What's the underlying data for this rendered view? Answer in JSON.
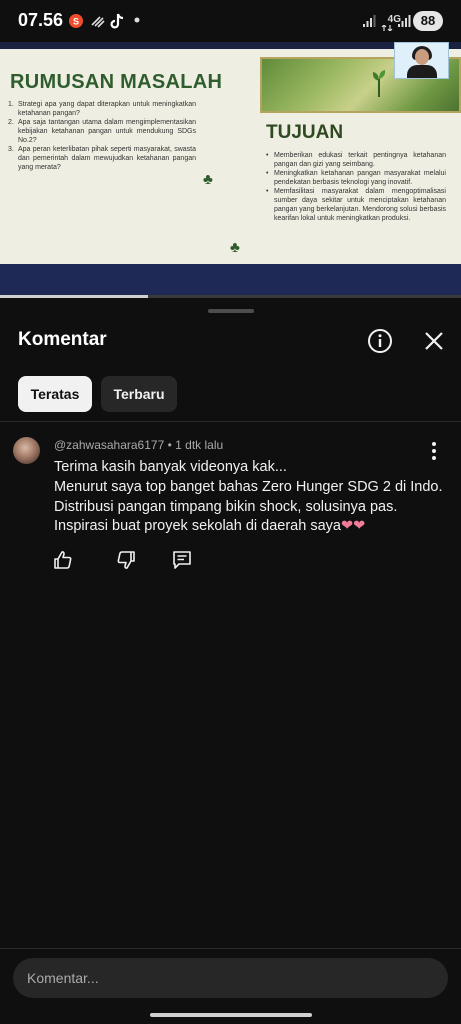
{
  "status_bar": {
    "time": "07.56",
    "network": "4G",
    "battery": "88",
    "icons": [
      "shopee-icon",
      "muted-icon",
      "tiktok-icon",
      "notification-dot-icon",
      "signal-icon",
      "data-icon",
      "signal-icon-2"
    ]
  },
  "video": {
    "progress": 0.32,
    "slide": {
      "title": "RUMUSAN MASALAH",
      "problems": [
        {
          "num": "1.",
          "text": "Strategi apa yang dapat diterapkan untuk meningkatkan ketahanan pangan?"
        },
        {
          "num": "2.",
          "text": "Apa saja tantangan utama dalam mengimplementasikan kebijakan ketahanan pangan untuk mendukung SDGs No.2?"
        },
        {
          "num": "3.",
          "text": "Apa peran keterlibatan pihak seperti masyarakat, swasta dan pemerintah dalam mewujudkan ketahanan pangan yang merata?"
        }
      ],
      "goals_title": "TUJUAN",
      "goals": [
        "Memberikan edukasi terkait pentingnya ketahanan pangan dan gizi yang seimbang.",
        "Meningkatkan ketahanan pangan masyarakat melalui pendekatan berbasis teknologi yang inovatif.",
        "Memfasilitasi masyarakat dalam mengoptimalisasi sumber daya sekitar untuk menciptakan ketahanan pangan yang berkelanjutan. Mendorong solusi berbasis kearifan lokal untuk meningkatkan produksi."
      ]
    }
  },
  "comments": {
    "title": "Komentar",
    "tabs": [
      {
        "label": "Teratas",
        "active": true
      },
      {
        "label": "Terbaru",
        "active": false
      }
    ],
    "items": [
      {
        "author": "@zahwasahara6177",
        "time": "1 dtk lalu",
        "lines": [
          "Terima kasih banyak videonya kak...",
          "Menurut saya top banget bahas Zero Hunger SDG 2 di Indo.",
          "Distribusi pangan timpang bikin shock, solusinya pas.",
          "Inspirasi buat proyek sekolah di daerah saya"
        ],
        "emoji": "❤❤"
      }
    ],
    "input_placeholder": "Komentar..."
  },
  "colors": {
    "background": "#0f0f0f",
    "chip_active": "#f1f1f1",
    "chip_inactive": "#272727",
    "slide_bg": "#efeee2",
    "slide_title": "#2f5d2d",
    "heart": "#f07c97"
  }
}
